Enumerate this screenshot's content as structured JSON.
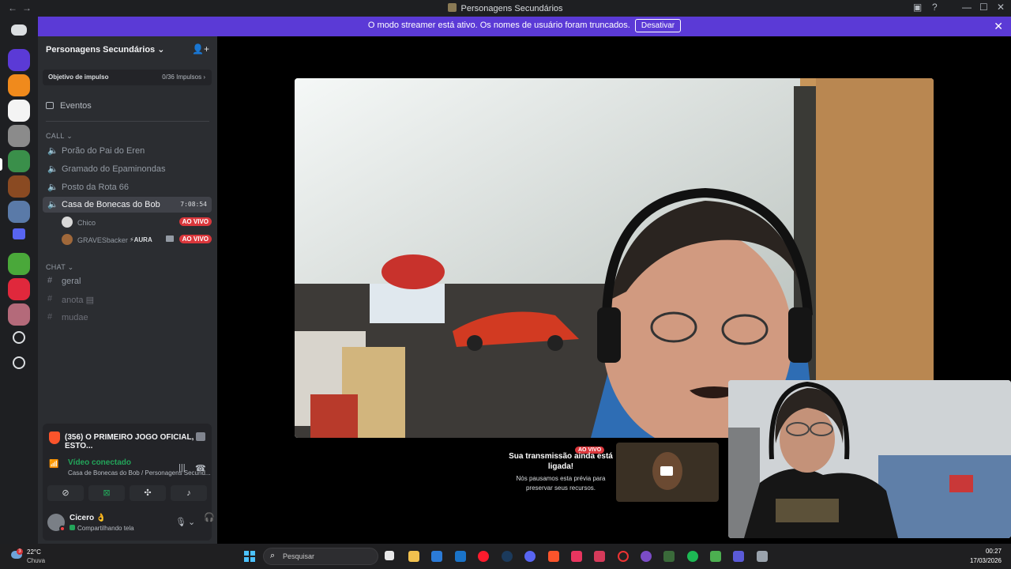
{
  "window": {
    "title": "Personagens Secundários",
    "back": "←",
    "forward": "→"
  },
  "banner": {
    "message": "O modo streamer está ativo. Os nomes de usuário foram truncados.",
    "button": "Desativar",
    "close": "✕"
  },
  "server": {
    "name": "Personagens Secundários",
    "boost_label": "Objetivo de impulso",
    "boost_value": "0/36 Impulsos"
  },
  "events_label": "Eventos",
  "categories": {
    "call": "CALL",
    "chat": "CHAT"
  },
  "voice_channels": [
    {
      "label": "Porão do Pai do Eren"
    },
    {
      "label": "Gramado do Epaminondas"
    },
    {
      "label": "Posto da Rota 66"
    },
    {
      "label": "Casa de Bonecas do Bob",
      "timer": "7:08:54"
    }
  ],
  "members": [
    {
      "name": "Chico",
      "status": "AO VIVO"
    },
    {
      "name": "GRAVESbacker",
      "tag": "AURA",
      "status": "AO VIVO"
    }
  ],
  "text_channels": [
    {
      "label": "geral"
    },
    {
      "label": "anota"
    },
    {
      "label": "mudae"
    }
  ],
  "now_playing": "(356) O PRIMEIRO JOGO OFICIAL, ESTO...",
  "voice_status": {
    "title": "Vídeo conectado",
    "subtitle": "Casa de Bonecas do Bob / Personagens Secund..."
  },
  "user": {
    "name": "Cicero",
    "emoji": "👌",
    "status": "Compartilhando tela"
  },
  "stream_paused": {
    "badge": "AO VIVO",
    "heading": "Sua transmissão ainda está ligada!",
    "body": "Nós pausamos esta prévia para preservar seus recursos."
  },
  "taskbar": {
    "weather_temp": "22°C",
    "weather_desc": "Chuva",
    "weather_badge": "3",
    "search_placeholder": "Pesquisar",
    "time": "00:27",
    "date": "17/03/2026"
  },
  "colors": {
    "accent": "#5865f2",
    "banner": "#5b3ad6",
    "live": "#da373c",
    "connected": "#23a55a"
  }
}
